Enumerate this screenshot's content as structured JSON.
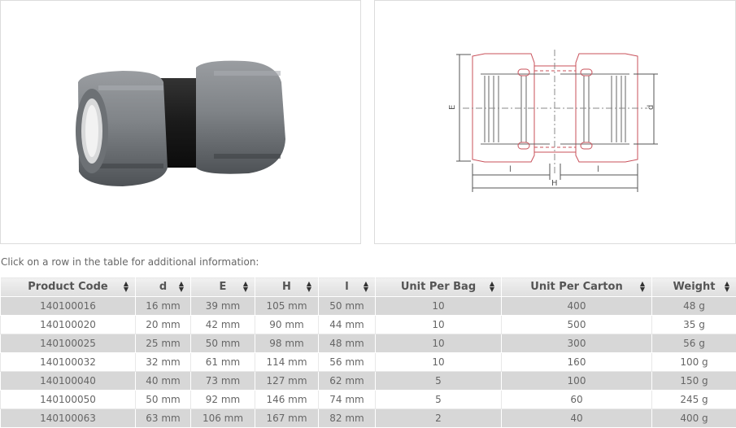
{
  "hint": "Click on a row in the table for additional information:",
  "drawing_labels": {
    "E": "E",
    "d": "d",
    "l": "l",
    "H": "H"
  },
  "table": {
    "headers": [
      "Product Code",
      "d",
      "E",
      "H",
      "l",
      "Unit Per Bag",
      "Unit Per Carton",
      "Weight"
    ],
    "rows": [
      [
        "140100016",
        "16 mm",
        "39 mm",
        "105 mm",
        "50 mm",
        "10",
        "400",
        "48 g"
      ],
      [
        "140100020",
        "20 mm",
        "42 mm",
        "90 mm",
        "44 mm",
        "10",
        "500",
        "35 g"
      ],
      [
        "140100025",
        "25 mm",
        "50 mm",
        "98 mm",
        "48 mm",
        "10",
        "300",
        "56 g"
      ],
      [
        "140100032",
        "32 mm",
        "61 mm",
        "114 mm",
        "56 mm",
        "10",
        "160",
        "100 g"
      ],
      [
        "140100040",
        "40 mm",
        "73 mm",
        "127 mm",
        "62 mm",
        "5",
        "100",
        "150 g"
      ],
      [
        "140100050",
        "50 mm",
        "92 mm",
        "146 mm",
        "74 mm",
        "5",
        "60",
        "245 g"
      ],
      [
        "140100063",
        "63 mm",
        "106 mm",
        "167 mm",
        "82 mm",
        "2",
        "40",
        "400 g"
      ]
    ]
  }
}
